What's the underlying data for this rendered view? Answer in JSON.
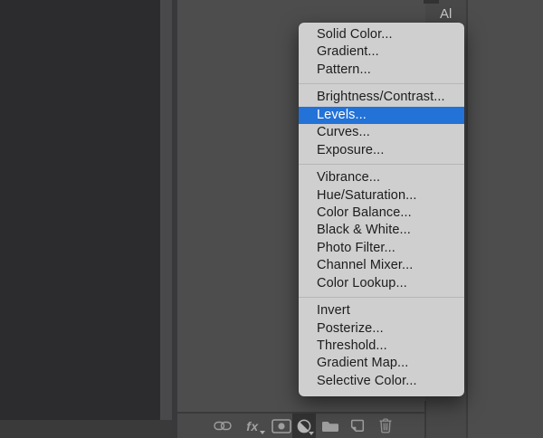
{
  "header": {
    "partial_text": "Al"
  },
  "menu": {
    "highlighted_label": "Levels...",
    "groups": [
      {
        "items": [
          "Solid Color...",
          "Gradient...",
          "Pattern..."
        ]
      },
      {
        "items": [
          "Brightness/Contrast...",
          "Levels...",
          "Curves...",
          "Exposure..."
        ]
      },
      {
        "items": [
          "Vibrance...",
          "Hue/Saturation...",
          "Color Balance...",
          "Black & White...",
          "Photo Filter...",
          "Channel Mixer...",
          "Color Lookup..."
        ]
      },
      {
        "items": [
          "Invert",
          "Posterize...",
          "Threshold...",
          "Gradient Map...",
          "Selective Color..."
        ]
      }
    ]
  },
  "toolbar": {
    "fx_label": "fx",
    "icons": [
      {
        "name": "link-layers-icon",
        "active": false
      },
      {
        "name": "layer-effects-icon",
        "active": false
      },
      {
        "name": "add-layer-mask-icon",
        "active": false
      },
      {
        "name": "new-adjustment-layer-icon",
        "active": true
      },
      {
        "name": "new-group-icon",
        "active": false
      },
      {
        "name": "new-layer-icon",
        "active": false
      },
      {
        "name": "delete-layer-icon",
        "active": false
      }
    ]
  },
  "colors": {
    "selection_blue": "#2272d8",
    "menu_bg": "#cfcfcf",
    "menu_text": "#1c1c1c",
    "canvas_dark": "#2c2c2e",
    "panel_bg": "#4d4d4d",
    "icon_gray": "#9e9e9e",
    "pressed_bg": "#323232"
  }
}
